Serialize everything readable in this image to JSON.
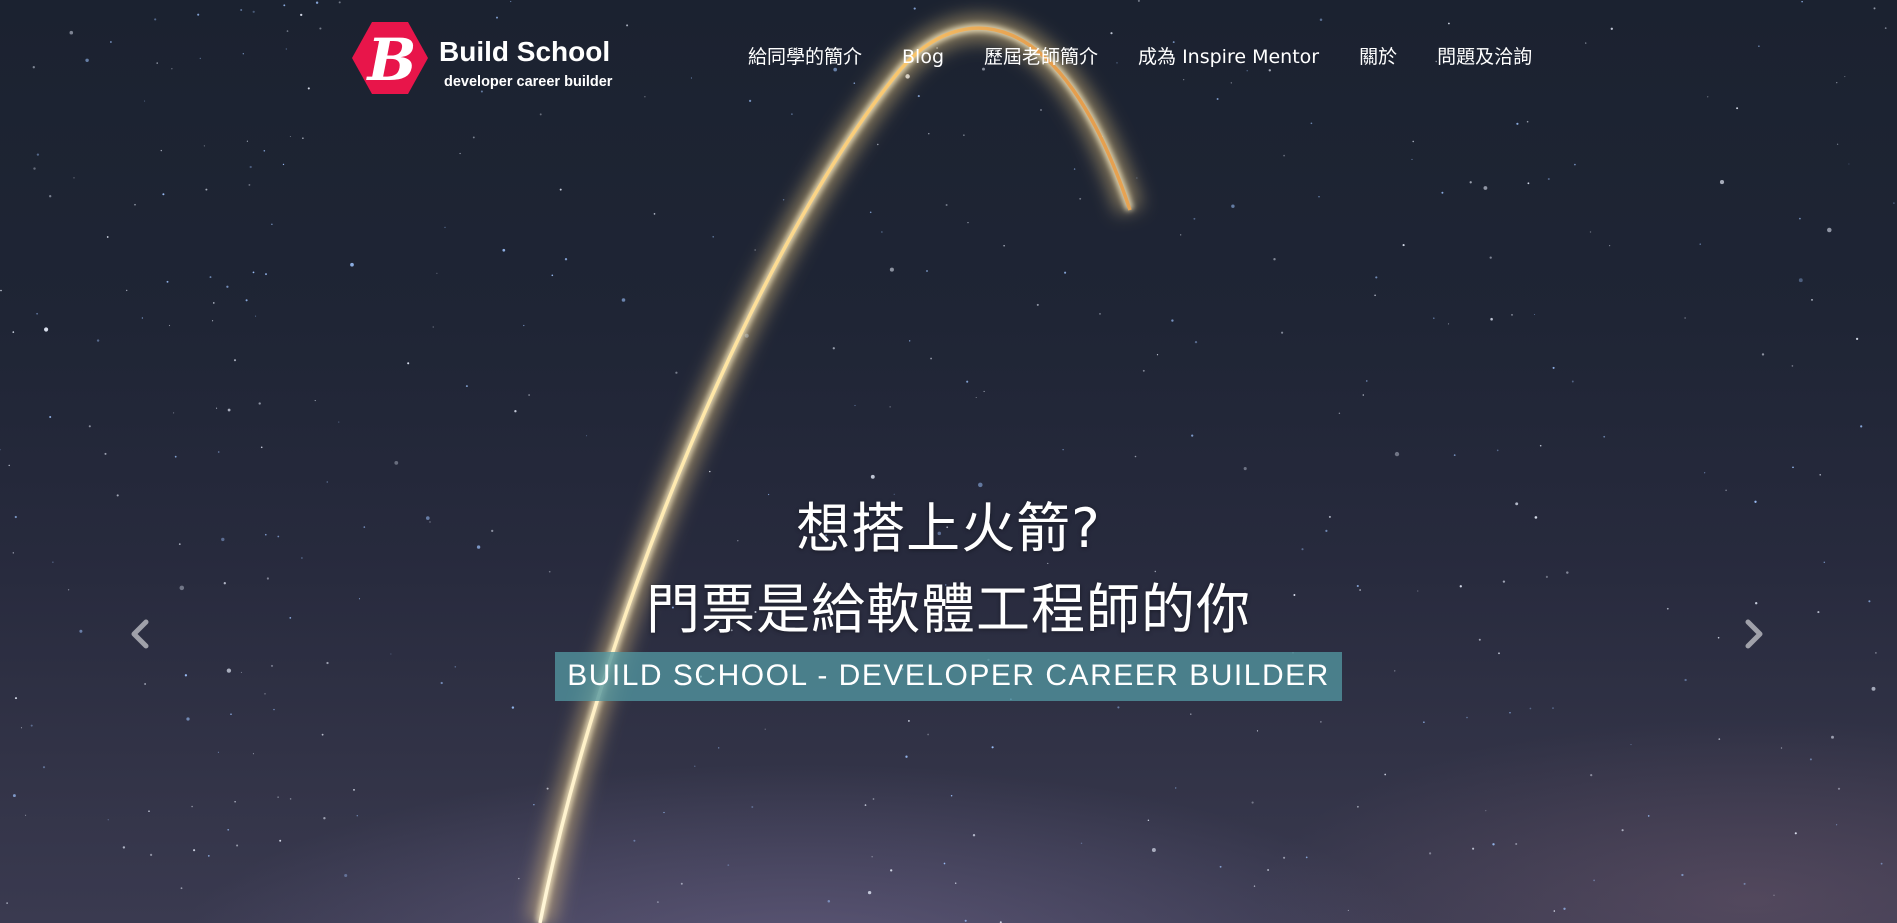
{
  "brand": {
    "logo_letter": "B",
    "title": "Build School",
    "subtitle": "developer career builder",
    "color": "#e8154a"
  },
  "nav": {
    "items": [
      {
        "label": "給同學的簡介"
      },
      {
        "label": "Blog"
      },
      {
        "label": "歷屆老師簡介"
      },
      {
        "label": "成為 Inspire Mentor"
      },
      {
        "label": "關於"
      },
      {
        "label": "問題及洽詢"
      }
    ]
  },
  "hero": {
    "line1": "想搭上火箭?",
    "line2": "門票是給軟體工程師的你",
    "tag": "BUILD SCHOOL - DEVELOPER CAREER BUILDER",
    "tag_color": "#5296a0"
  },
  "carousel": {
    "prev_icon": "chevron-left-icon",
    "next_icon": "chevron-right-icon"
  }
}
